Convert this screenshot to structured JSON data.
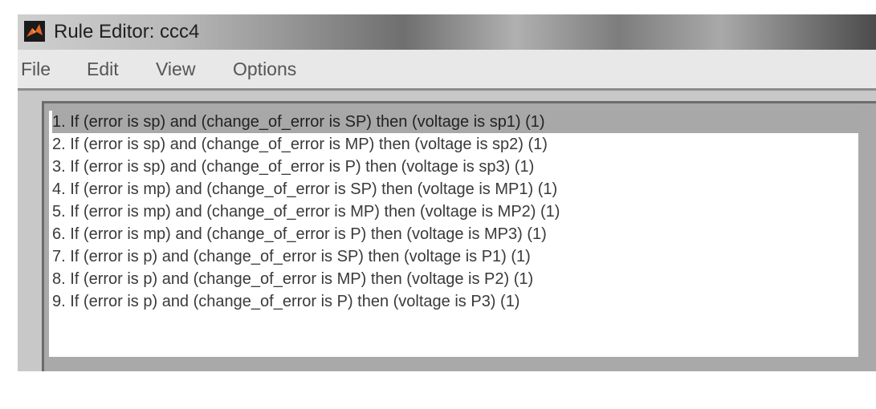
{
  "window": {
    "title": "Rule Editor: ccc4",
    "icon": "matlab-logo-icon"
  },
  "menu": {
    "file": "File",
    "edit": "Edit",
    "view": "View",
    "options": "Options"
  },
  "rules": [
    "1. If (error is sp) and (change_of_error is SP) then (voltage is sp1) (1)",
    "2. If (error is sp) and (change_of_error is MP) then (voltage is sp2) (1)",
    "3. If (error is sp) and (change_of_error is P) then (voltage is sp3) (1)",
    "4. If (error is mp) and (change_of_error is SP) then (voltage is MP1) (1)",
    "5. If (error is mp) and (change_of_error is MP) then (voltage is MP2) (1)",
    "6. If (error is mp) and (change_of_error is P) then (voltage is MP3) (1)",
    "7. If (error is p) and (change_of_error is SP) then (voltage is P1) (1)",
    "8. If (error is p) and (change_of_error is MP) then (voltage is P2) (1)",
    "9. If (error is p) and (change_of_error is P) then (voltage is P3) (1)"
  ],
  "selected_rule_index": 0
}
